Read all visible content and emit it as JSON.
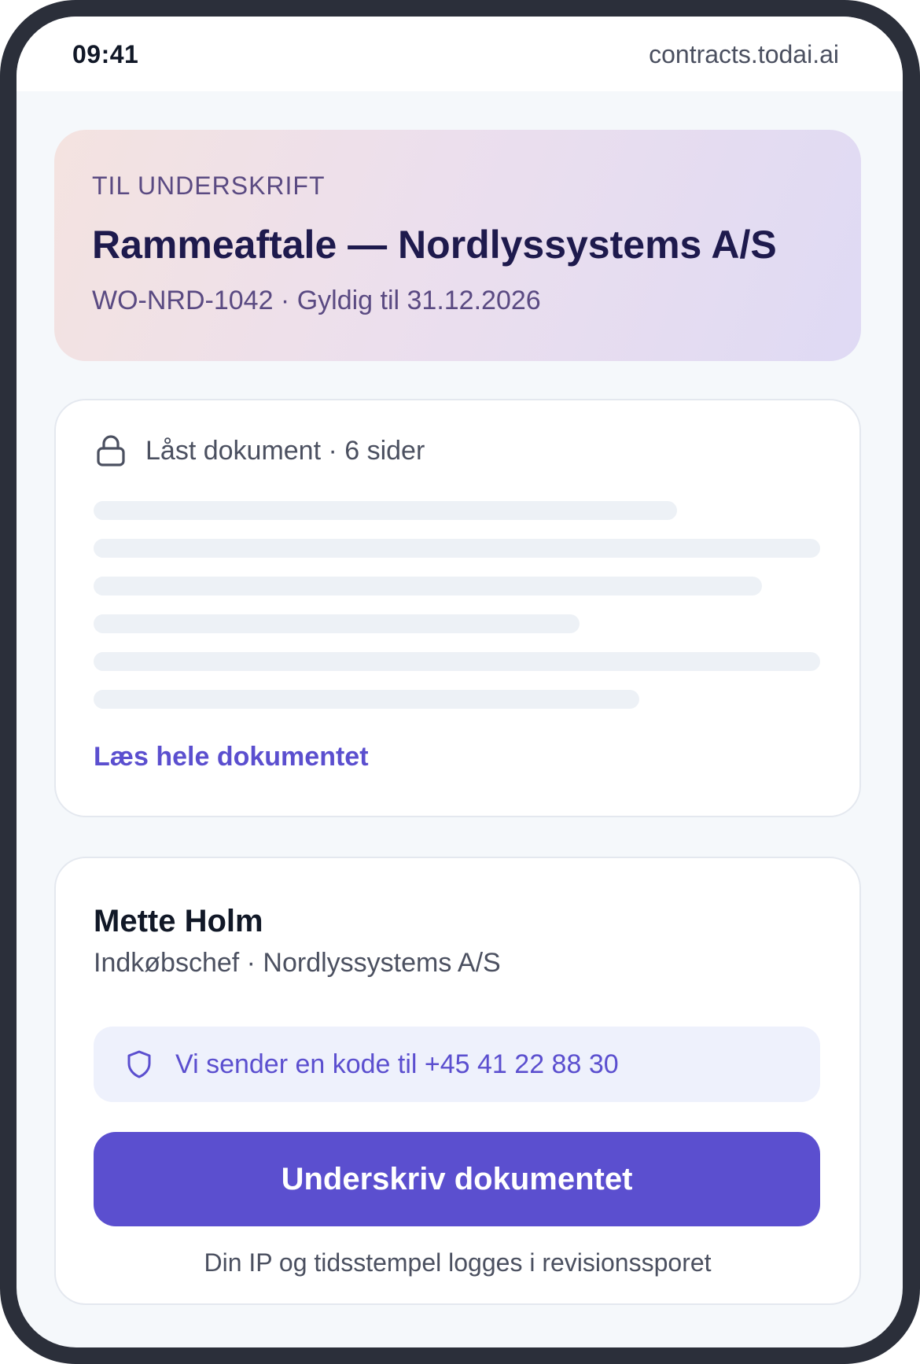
{
  "status_bar": {
    "time": "09:41",
    "url": "contracts.todai.ai"
  },
  "header": {
    "eyebrow": "TIL UNDERSKRIFT",
    "title": "Rammeaftale — Nordlyssystems A/S",
    "subtitle": "WO-NRD-1042 · Gyldig til 31.12.2026"
  },
  "document": {
    "icon": "lock-icon",
    "status": "Låst dokument · 6 sider",
    "read_link": "Læs hele dokumentet"
  },
  "signer": {
    "name": "Mette Holm",
    "role": "Indkøbschef · Nordlyssystems A/S",
    "otp_icon": "shield-icon",
    "otp_text": "Vi sender en kode til +45 41 22 88 30",
    "sign_button": "Underskriv dokumentet",
    "audit_note": "Din IP og tidsstempel logges i revisionssporet"
  },
  "colors": {
    "accent": "#5b4fcf",
    "frame": "#2b2f3a",
    "title": "#1e1a4d"
  }
}
